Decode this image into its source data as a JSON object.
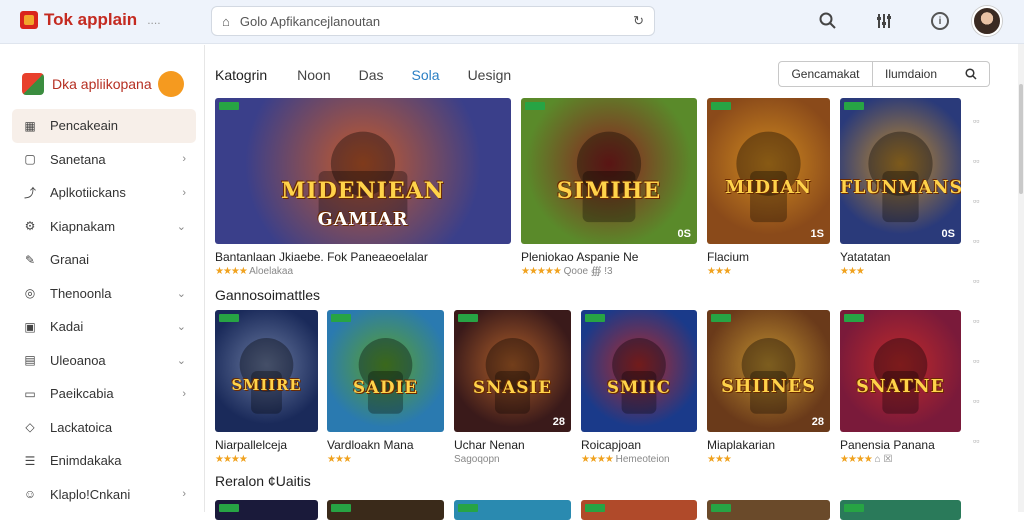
{
  "app": {
    "title": "Tok applain",
    "dots": "....",
    "search_value": "Golo Apfikancejlanoutan",
    "search_placeholder": "Golo Apfikancejlanoutan"
  },
  "sidebar": {
    "title": "Dka apliikopana",
    "items": [
      {
        "label": "Pencakeain",
        "icon": "grid-icon",
        "chev": ""
      },
      {
        "label": "Sanetana",
        "icon": "box-icon",
        "chev": "›"
      },
      {
        "label": "Aplkotiickans",
        "icon": "chart-icon",
        "chev": "›"
      },
      {
        "label": "Kiapnakam",
        "icon": "gear-icon",
        "chev": "⌄"
      },
      {
        "label": "Granai",
        "icon": "pen-icon",
        "chev": ""
      },
      {
        "label": "Thenoonla",
        "icon": "pin-icon",
        "chev": "⌄"
      },
      {
        "label": "Kadai",
        "icon": "bag-icon",
        "chev": "⌄"
      },
      {
        "label": "Uleoanoa",
        "icon": "doc-icon",
        "chev": "⌄"
      },
      {
        "label": "Paeikcabia",
        "icon": "folder-icon",
        "chev": "›"
      },
      {
        "label": "Lackatoica",
        "icon": "tag-icon",
        "chev": ""
      },
      {
        "label": "Enimdakaka",
        "icon": "list-icon",
        "chev": ""
      },
      {
        "label": "Klaplo!Cnkani",
        "icon": "user-icon",
        "chev": "›"
      }
    ]
  },
  "categories": {
    "title": "Katogrin",
    "tabs": [
      "Noon",
      "Das",
      "Sola",
      "Uesign"
    ],
    "active_tab": 2,
    "btn1": "Gencamakat",
    "btn2": "Ilumdaion"
  },
  "row1": [
    {
      "name": "Bantanlaan Jkiaebe. Fok Paneaeoelalar",
      "stars": "★★★★",
      "meta": "Aloelakaa",
      "title": "MIDENIEAN",
      "sub": "GAMIAR",
      "num": "",
      "c1": "#3a3f8a",
      "c2": "#c45a2a"
    },
    {
      "name": "Pleniokao Aspanie Ne",
      "stars": "★★★★★",
      "meta": "Qooe ∰ !3",
      "title": "SIMIHE",
      "sub": "",
      "num": "0S",
      "c1": "#5a8a2a",
      "c2": "#8a2020"
    },
    {
      "name": "Flacium",
      "stars": "★★★",
      "meta": "",
      "title": "MIDIAN",
      "sub": "",
      "num": "1S",
      "c1": "#8a4a1a",
      "c2": "#d08a20"
    },
    {
      "name": "Yatatatan",
      "stars": "★★★",
      "meta": "",
      "title": "FLUNMANS",
      "sub": "",
      "num": "0S",
      "c1": "#2a3a7a",
      "c2": "#c08a2a"
    }
  ],
  "section2_title": "Gannosoimattles",
  "row2": [
    {
      "name": "Niarpallelceja",
      "stars": "★★★★",
      "meta": "",
      "title": "SMIIRE",
      "num": "",
      "c1": "#1a2a5a",
      "c2": "#6a7aa0"
    },
    {
      "name": "Vardloakn Mana",
      "stars": "★★★",
      "meta": "",
      "title": "SADIE",
      "num": "",
      "c1": "#2a7ab0",
      "c2": "#5aa02a"
    },
    {
      "name": "Uchar Nenan",
      "stars": "",
      "meta": "Sagoqopn",
      "title": "SNASIE",
      "num": "28",
      "c1": "#3a1a1a",
      "c2": "#b0602a"
    },
    {
      "name": "Roicapjoan",
      "stars": "★★★★",
      "meta": "Hemeoteion",
      "title": "SMIIC",
      "num": "",
      "c1": "#1a3a8a",
      "c2": "#b02a2a"
    },
    {
      "name": "Miaplakarian",
      "stars": "★★★",
      "meta": "",
      "title": "SHIINES",
      "num": "28",
      "c1": "#6a3a1a",
      "c2": "#c09030"
    },
    {
      "name": "Panensia Panana",
      "stars": "★★★★",
      "meta": "⌂ ☒",
      "title": "SNATNE",
      "num": "",
      "c1": "#7a1a3a",
      "c2": "#c02a2a"
    }
  ],
  "section3_title": "Reralon ¢Uaitis",
  "colors": {
    "accent": "#2a7fc4",
    "brand": "#c42a20",
    "star": "#f0a21f"
  }
}
